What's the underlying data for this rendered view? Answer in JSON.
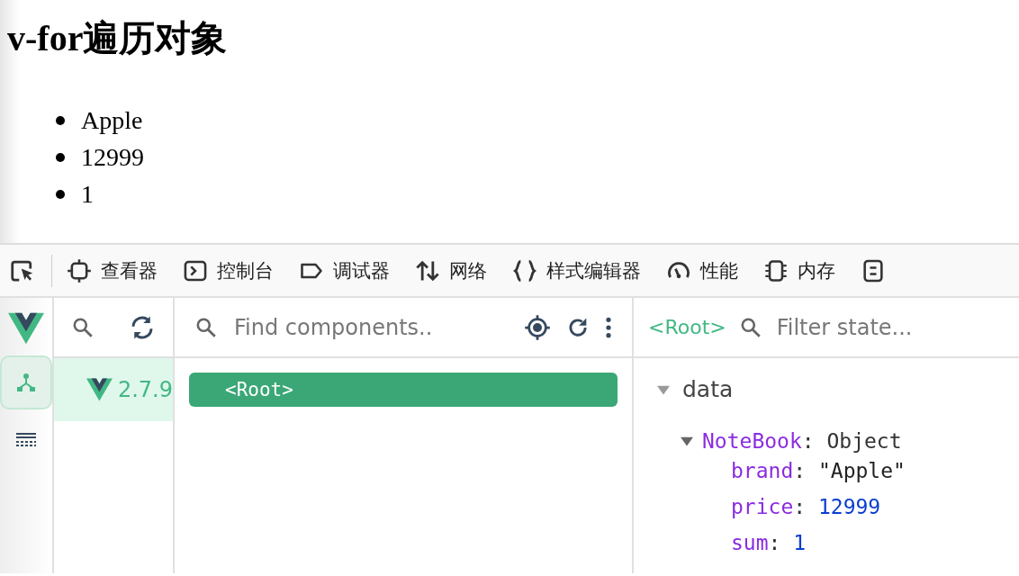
{
  "page": {
    "heading": "v-for遍历对象",
    "items": [
      "Apple",
      "12999",
      "1"
    ]
  },
  "devtools": {
    "tabs": [
      {
        "label": "查看器"
      },
      {
        "label": "控制台"
      },
      {
        "label": "调试器"
      },
      {
        "label": "网络"
      },
      {
        "label": "样式编辑器"
      },
      {
        "label": "性能"
      },
      {
        "label": "内存"
      }
    ],
    "sidebar": [
      {
        "selected": true
      },
      {
        "selected": false
      }
    ],
    "app_version": "2.7.9",
    "app_selected": true,
    "search_placeholder": "Find components..",
    "tree": [
      {
        "label": "<Root>",
        "selected": true
      }
    ],
    "state_title": "<Root>",
    "filter_placeholder": "Filter state...",
    "state": {
      "section": "data",
      "expanded": true,
      "object": {
        "name": "NoteBook",
        "colon": ":",
        "type": "Object",
        "expanded": true,
        "fields": [
          {
            "key": "brand",
            "colon": ":",
            "value": "\"Apple\"",
            "kind": "string"
          },
          {
            "key": "price",
            "colon": ":",
            "value": "12999",
            "kind": "number"
          },
          {
            "key": "sum",
            "colon": ":",
            "value": "1",
            "kind": "number"
          }
        ]
      }
    }
  }
}
